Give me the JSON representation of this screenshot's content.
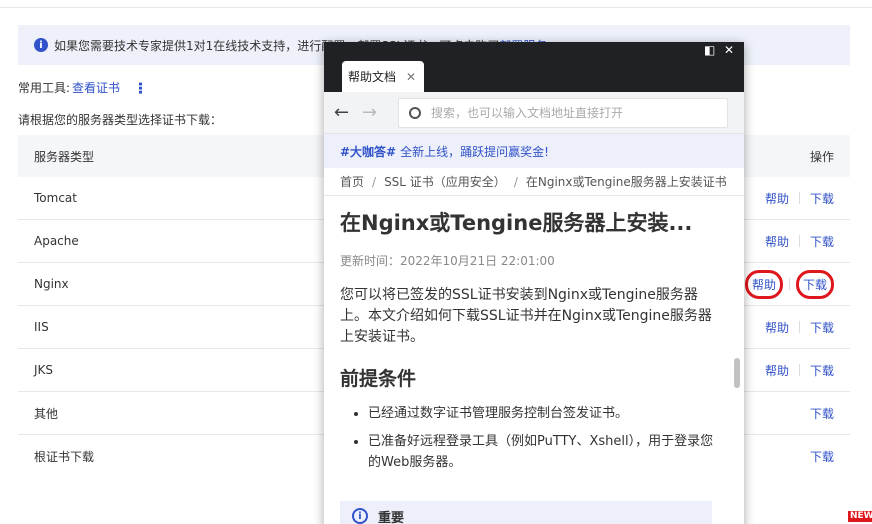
{
  "notice": {
    "text": "如果您需要技术专家提供1对1在线技术支持，进行配置、部署SSL证书，可点击购买",
    "link": "部署服务"
  },
  "tools": {
    "label": "常用工具:",
    "link": "查看证书"
  },
  "instruction": "请根据您的服务器类型选择证书下载：",
  "table": {
    "headers": {
      "type": "服务器类型",
      "action": "操作"
    },
    "rows": [
      {
        "name": "Tomcat",
        "help": "帮助",
        "download": "下载"
      },
      {
        "name": "Apache",
        "help": "帮助",
        "download": "下载"
      },
      {
        "name": "Nginx",
        "help": "帮助",
        "download": "下载"
      },
      {
        "name": "IIS",
        "help": "帮助",
        "download": "下载"
      },
      {
        "name": "JKS",
        "help": "帮助",
        "download": "下载"
      },
      {
        "name": "其他",
        "download": "下载"
      },
      {
        "name": "根证书下载",
        "download": "下载"
      }
    ]
  },
  "popup": {
    "tab_title": "帮助文档",
    "search_placeholder": "搜索，也可以输入文档地址直接打开",
    "promo": {
      "tag": "#大咖答#",
      "text": "全新上线，踊跃提问赢奖金!"
    },
    "breadcrumb": [
      "首页",
      "SSL 证书（应用安全）",
      "在Nginx或Tengine服务器上安装证书"
    ],
    "title": "在Nginx或Tengine服务器上安装...",
    "updated": "更新时间：2022年10月21日 22:01:00",
    "intro": "您可以将已签发的SSL证书安装到Nginx或Tengine服务器上。本文介绍如何下载SSL证书并在Nginx或Tengine服务器上安装证书。",
    "section": "前提条件",
    "bullets": [
      "已经通过数字证书管理服务控制台签发证书。",
      "已准备好远程登录工具（例如PuTTY、Xshell），用于登录您的Web服务器。"
    ],
    "note": "重要"
  },
  "badge": "NEW",
  "colors": {
    "accent": "#3152c8",
    "highlight": "#e0161d"
  }
}
